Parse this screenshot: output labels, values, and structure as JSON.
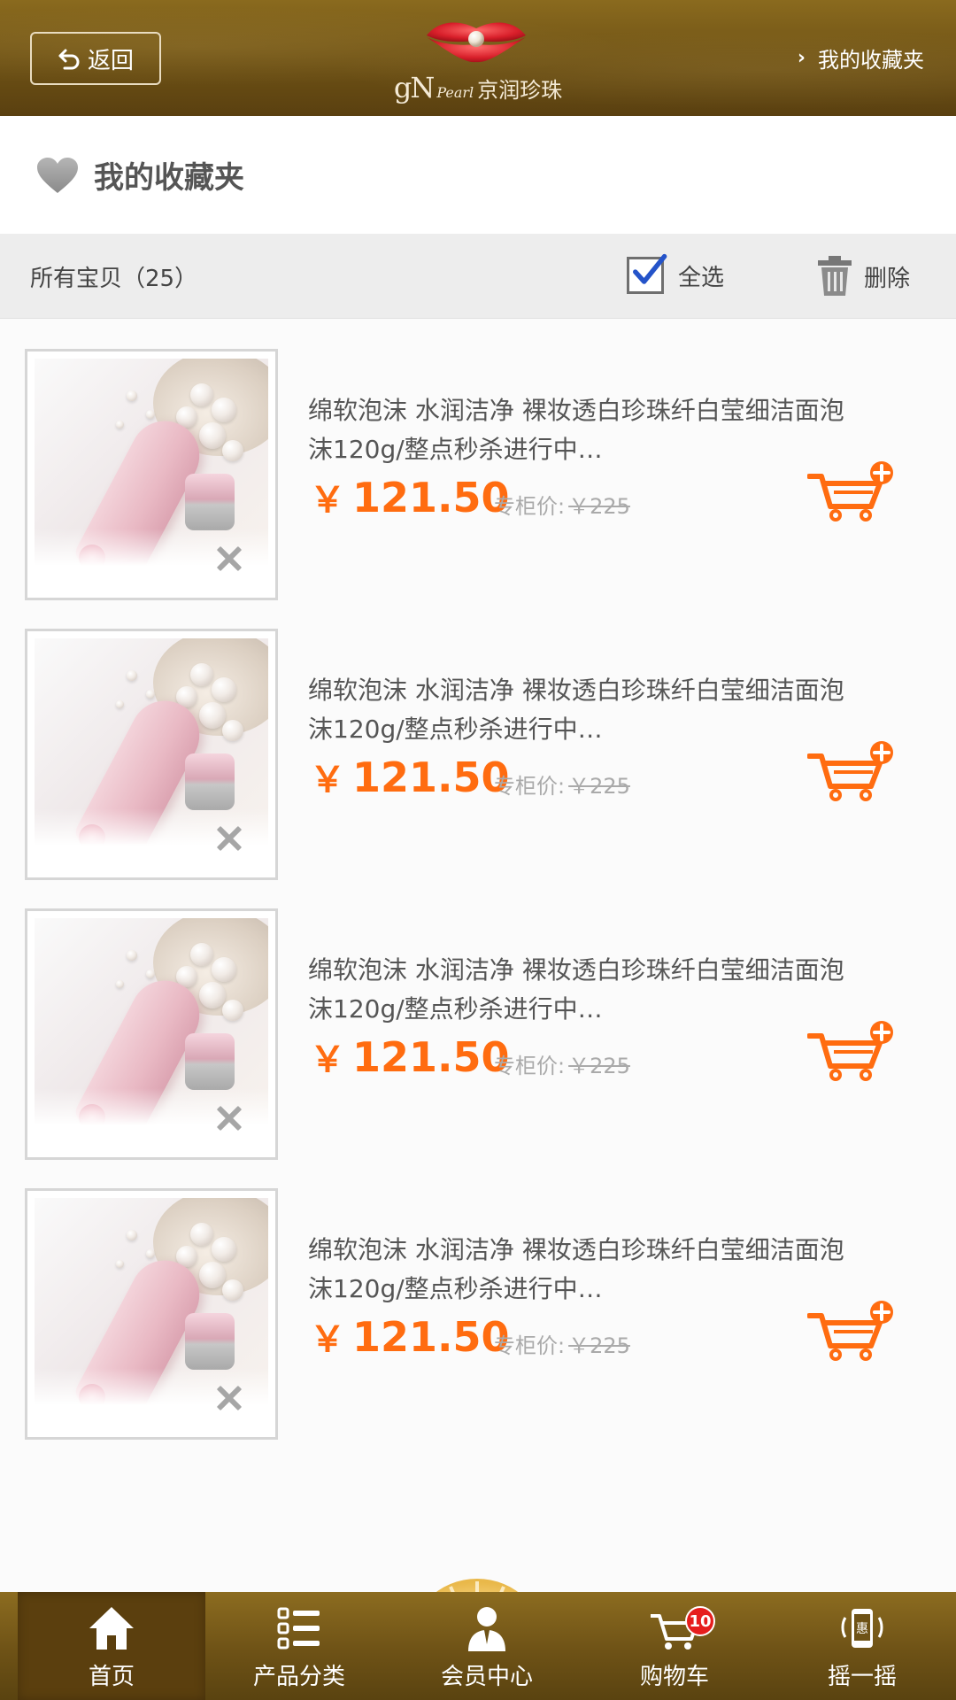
{
  "header": {
    "back_label": "返回",
    "logo_gn": "gN",
    "logo_pearl": "Pearl",
    "logo_cn": "京润珍珠",
    "fav_link_label": "我的收藏夹"
  },
  "page": {
    "title": "我的收藏夹",
    "title_icon": "heart-icon"
  },
  "toolbar": {
    "all_items_label": "所有宝贝（25）",
    "select_all_label": "全选",
    "select_all_checked": true,
    "delete_label": "删除"
  },
  "products": [
    {
      "title": "绵软泡沫 水润洁净 裸妆透白珍珠纤白莹细洁面泡沫120g/整点秒杀进行中…",
      "price_symbol": "￥",
      "price": "121.50",
      "counter_label": "专柜价:",
      "counter_price": "￥225"
    },
    {
      "title": "绵软泡沫 水润洁净 裸妆透白珍珠纤白莹细洁面泡沫120g/整点秒杀进行中…",
      "price_symbol": "￥",
      "price": "121.50",
      "counter_label": "专柜价:",
      "counter_price": "￥225"
    },
    {
      "title": "绵软泡沫 水润洁净 裸妆透白珍珠纤白莹细洁面泡沫120g/整点秒杀进行中…",
      "price_symbol": "￥",
      "price": "121.50",
      "counter_label": "专柜价:",
      "counter_price": "￥225"
    },
    {
      "title": "绵软泡沫 水润洁净 裸妆透白珍珠纤白莹细洁面泡沫120g/整点秒杀进行中…",
      "price_symbol": "￥",
      "price": "121.50",
      "counter_label": "专柜价:",
      "counter_price": "￥225"
    }
  ],
  "tabbar": {
    "tabs": [
      {
        "label": "首页",
        "icon": "home-icon",
        "active": true
      },
      {
        "label": "产品分类",
        "icon": "category-list-icon",
        "active": false
      },
      {
        "label": "会员中心",
        "icon": "member-icon",
        "active": false
      },
      {
        "label": "购物车",
        "icon": "cart-icon",
        "active": false,
        "badge": "10"
      },
      {
        "label": "摇一摇",
        "icon": "shake-phone-icon",
        "active": false,
        "icon_text": "惠"
      }
    ]
  },
  "colors": {
    "header_brown": "#6b4f14",
    "price_orange": "#ff6c10",
    "badge_red": "#e61d1d",
    "checkbox_blue": "#2453c9"
  }
}
